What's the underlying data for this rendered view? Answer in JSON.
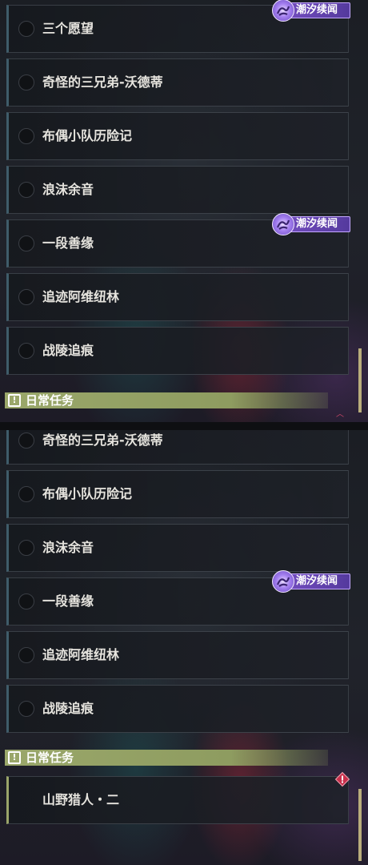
{
  "top_panel": {
    "quests": [
      {
        "label": "三个愿望",
        "badge": true
      },
      {
        "label": "奇怪的三兄弟-沃德蒂",
        "badge": false
      },
      {
        "label": "布偶小队历险记",
        "badge": false
      },
      {
        "label": "浪沫余音",
        "badge": false
      },
      {
        "label": "一段善缘",
        "badge": true
      },
      {
        "label": "追迹阿维纽林",
        "badge": false
      },
      {
        "label": "战陵追痕",
        "badge": false
      }
    ],
    "section_header": "日常任务"
  },
  "bottom_panel": {
    "quests": [
      {
        "label": "奇怪的三兄弟-沃德蒂",
        "badge": false
      },
      {
        "label": "布偶小队历险记",
        "badge": false
      },
      {
        "label": "浪沫余音",
        "badge": false
      },
      {
        "label": "一段善缘",
        "badge": true
      },
      {
        "label": "追迹阿维纽林",
        "badge": false
      },
      {
        "label": "战陵追痕",
        "badge": false
      }
    ],
    "section_header": "日常任务",
    "daily_quests": [
      {
        "label": "山野猎人・二"
      }
    ]
  },
  "badge_label": "潮汐续闻",
  "colors": {
    "badge_purple": "#7a52c8",
    "section_green": "#9aa76a",
    "alert_red": "#c8304c",
    "scrollbar": "#b9ad7c"
  },
  "icons": {
    "section": "exclamation-box-icon",
    "badge": "tide-emblem-icon",
    "alert": "diamond-alert-icon"
  }
}
